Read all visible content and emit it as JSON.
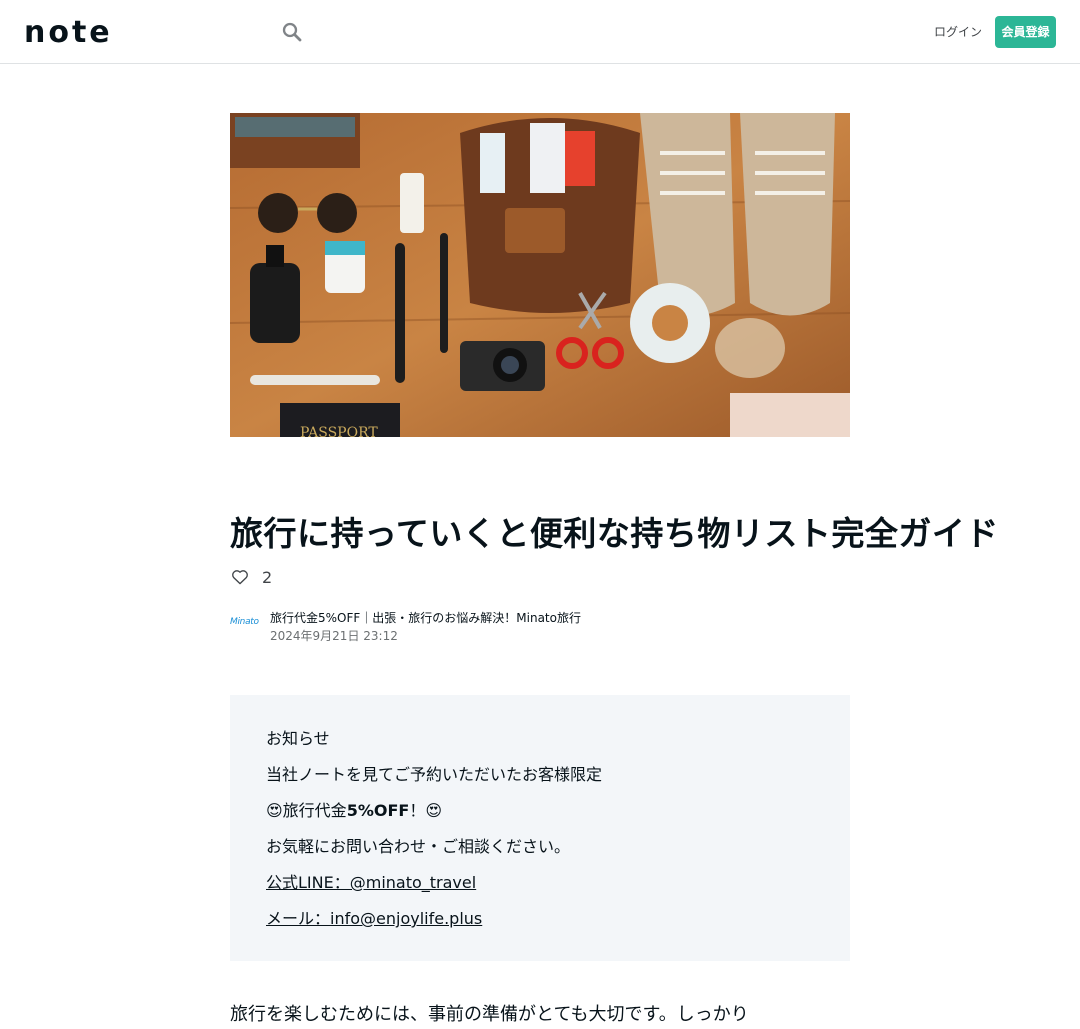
{
  "header": {
    "logo_text": "note",
    "login_label": "ログイン",
    "signup_label": "会員登録",
    "signup_color": "#2cb696"
  },
  "article": {
    "hero_icon": "travel-packing-flatlay-image",
    "hero_passport_text": "PASSPORT",
    "title": "旅行に持っていくと便利な持ち物リスト完全ガイド",
    "likes": "2",
    "author_avatar_text": "Minato",
    "author_name": "旅行代金5%OFF｜出張・旅行のお悩み解決！Minato旅行",
    "date": "2024年9月21日 23:12",
    "promo": {
      "line1": "お知らせ",
      "line2": "当社ノートを見てご予約いただいたお客様限定",
      "line3_prefix": "😍旅行代金",
      "line3_bold": "5%OFF",
      "line3_suffix": "！😍",
      "line4": "お気軽にお問い合わせ・ご相談ください。",
      "line5_prefix": "公式",
      "line5_link": "LINE：@minato_travel",
      "line6_prefix": "メール：",
      "line6_link": "info@enjoylife.plus"
    },
    "body_first": "旅行を楽しむためには、事前の準備がとても大切です。しっかり"
  }
}
